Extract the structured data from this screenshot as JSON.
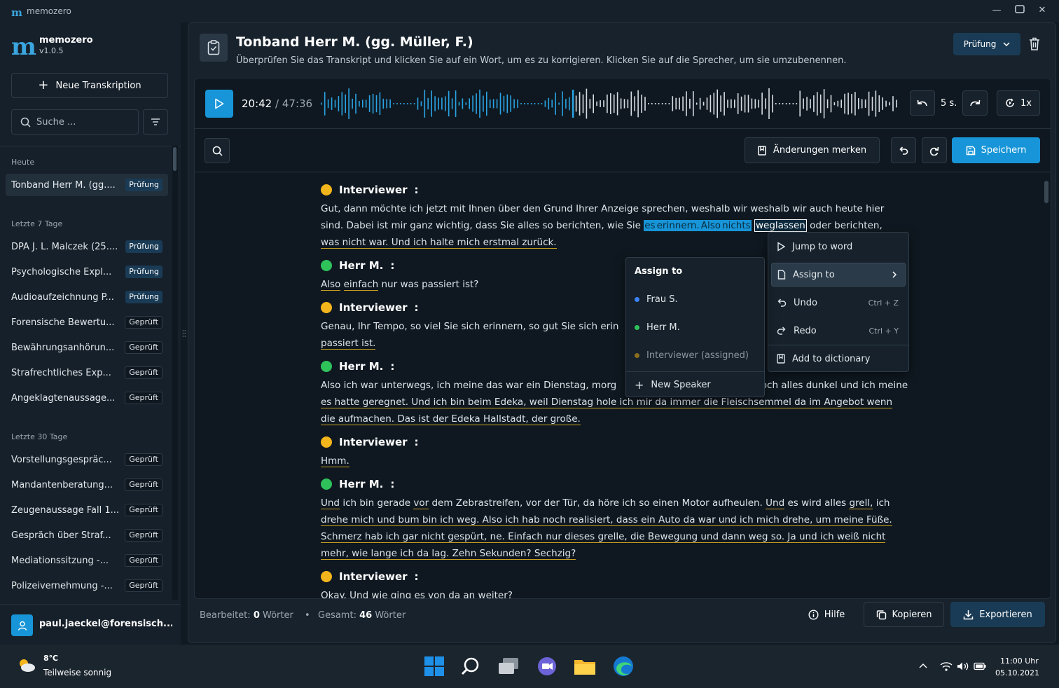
{
  "window": {
    "app_name": "memozero"
  },
  "sidebar": {
    "brand": {
      "name": "memozero",
      "version": "v1.0.5"
    },
    "new_button": "Neue Transkription",
    "search_placeholder": "Suche ...",
    "groups": [
      {
        "label": "Heute",
        "items": [
          {
            "title": "Tonband Herr M. (gg....",
            "status": "Prüfung",
            "selected": true
          }
        ]
      },
      {
        "label": "Letzte 7 Tage",
        "items": [
          {
            "title": "DPA J. L. Malczek (25....",
            "status": "Prüfung"
          },
          {
            "title": "Psychologische Expl...",
            "status": "Prüfung"
          },
          {
            "title": "Audioaufzeichnung P...",
            "status": "Prüfung"
          },
          {
            "title": "Forensische Bewertu...",
            "status": "Geprüft"
          },
          {
            "title": "Bewährungsanhörun...",
            "status": "Geprüft"
          },
          {
            "title": "Strafrechtliches Exp...",
            "status": "Geprüft"
          },
          {
            "title": "Angeklagtenaussage...",
            "status": "Geprüft"
          }
        ]
      },
      {
        "label": "Letzte 30 Tage",
        "items": [
          {
            "title": "Vorstellungsgespräc...",
            "status": "Geprüft"
          },
          {
            "title": "Mandantenberatung...",
            "status": "Geprüft"
          },
          {
            "title": "Zeugenaussage Fall 1...",
            "status": "Geprüft"
          },
          {
            "title": "Gespräch über Straf...",
            "status": "Geprüft"
          },
          {
            "title": "Mediationssitzung -...",
            "status": "Geprüft"
          },
          {
            "title": "Polizeivernehmung -...",
            "status": "Geprüft"
          }
        ]
      }
    ],
    "user": "paul.jaeckel@forensisch..."
  },
  "header": {
    "title": "Tonband Herr M. (gg. Müller, F.)",
    "subtitle": "Überprüfen Sie das Transkript und klicken Sie auf ein Wort, um es zu korrigieren. Klicken Sie auf die Sprecher, um sie umzubenennen.",
    "status": "Prüfung"
  },
  "player": {
    "current": "20:42",
    "separator": "/",
    "total": "47:36",
    "skip": "5 s.",
    "speed": "1x",
    "progress": 0.435
  },
  "toolbar": {
    "track_changes": "Änderungen merken",
    "save": "Speichern"
  },
  "transcript": [
    {
      "speaker": "Interviewer",
      "color": "#f2b51b",
      "lines": [
        [
          "Gut, dann möchte ich jetzt mit Ihnen über den Grund Ihrer Anzeige sprechen, weshalb wir weshalb wir auch heute hier"
        ],
        [
          "sind. Dabei ist mir ganz wichtig, dass Sie alles so berichten, wie Sie ",
          "es",
          "erinnern.",
          "Also",
          "nichts",
          "weglassen",
          "oder berichten,"
        ],
        [
          "was nicht war. Und ich halte mich erstmal zurück."
        ]
      ]
    },
    {
      "speaker": "Herr M.",
      "color": "#2fc25b",
      "lines": [
        [
          "Also",
          "einfach",
          "nur was passiert ist?"
        ]
      ]
    },
    {
      "speaker": "Interviewer",
      "color": "#f2b51b",
      "lines": [
        [
          "Genau, Ihr Tempo, so viel Sie sich erinnern, so gut Sie sich erin"
        ],
        [
          "passiert ist."
        ]
      ]
    },
    {
      "speaker": "Herr M.",
      "color": "#2fc25b",
      "lines": [
        [
          "Also ich war unterwegs, ich meine das war ein Dienstag, morg",
          "noch alles dunkel und ich meine"
        ],
        [
          "es hatte geregnet. Und ich bin beim Edeka, weil Dienstag hole ich mir da immer die Fleischsemmel da im Angebot wenn"
        ],
        [
          "die aufmachen. Das ist der Edeka Hallstadt, der große."
        ]
      ]
    },
    {
      "speaker": "Interviewer",
      "color": "#f2b51b",
      "lines": [
        [
          "Hmm."
        ]
      ]
    },
    {
      "speaker": "Herr M.",
      "color": "#2fc25b",
      "lines": [
        [
          "Und",
          "ich bin gerade",
          "vor",
          "dem Zebrastreifen, vor der Tür, da höre ich so einen Motor aufheulen.",
          "Und",
          "es wird alles",
          "grell,",
          "ich"
        ],
        [
          "drehe mich und bum bin ich weg. Also ich hab noch realisiert, dass ein Auto da war und ich mich drehe, um meine Füße."
        ],
        [
          "Schmerz hab ich gar nicht gespürt, ne. Einfach nur dieses grelle, die Bewegung und dann weg so. Ja und ich weiß nicht"
        ],
        [
          "mehr, wie lange ich da lag. Zehn Sekunden? Sechzig?"
        ]
      ]
    },
    {
      "speaker": "Interviewer",
      "color": "#f2b51b",
      "lines": [
        [
          "Okay. Und wie ging es von da an weiter?"
        ]
      ]
    }
  ],
  "speaker_suffix": ":",
  "context_menu": {
    "items": [
      {
        "label": "Jump to word",
        "shortcut": ""
      },
      {
        "label": "Assign to",
        "shortcut": ""
      },
      {
        "label": "Undo",
        "shortcut": "Ctrl + Z"
      },
      {
        "label": "Redo",
        "shortcut": "Ctrl + Y"
      },
      {
        "label": "Add to dictionary",
        "shortcut": ""
      }
    ]
  },
  "assign_submenu": {
    "title": "Assign to",
    "speakers": [
      {
        "name": "Frau S.",
        "color": "#3b82f6"
      },
      {
        "name": "Herr M.",
        "color": "#2fc25b"
      },
      {
        "name": "Interviewer (assigned)",
        "color": "#8a6d1e"
      }
    ],
    "new_speaker": "New Speaker"
  },
  "footer": {
    "edited_label": "Bearbeitet:",
    "edited_count": "0",
    "edited_unit": "Wörter",
    "bullet": "•",
    "total_label": "Gesamt:",
    "total_count": "46",
    "total_unit": "Wörter",
    "help": "Hilfe",
    "copy": "Kopieren",
    "export": "Exportieren"
  },
  "taskbar": {
    "temp": "8℃",
    "weather": "Teilweise sonnig",
    "time": "11:00 Uhr",
    "date": "05.10.2021"
  }
}
